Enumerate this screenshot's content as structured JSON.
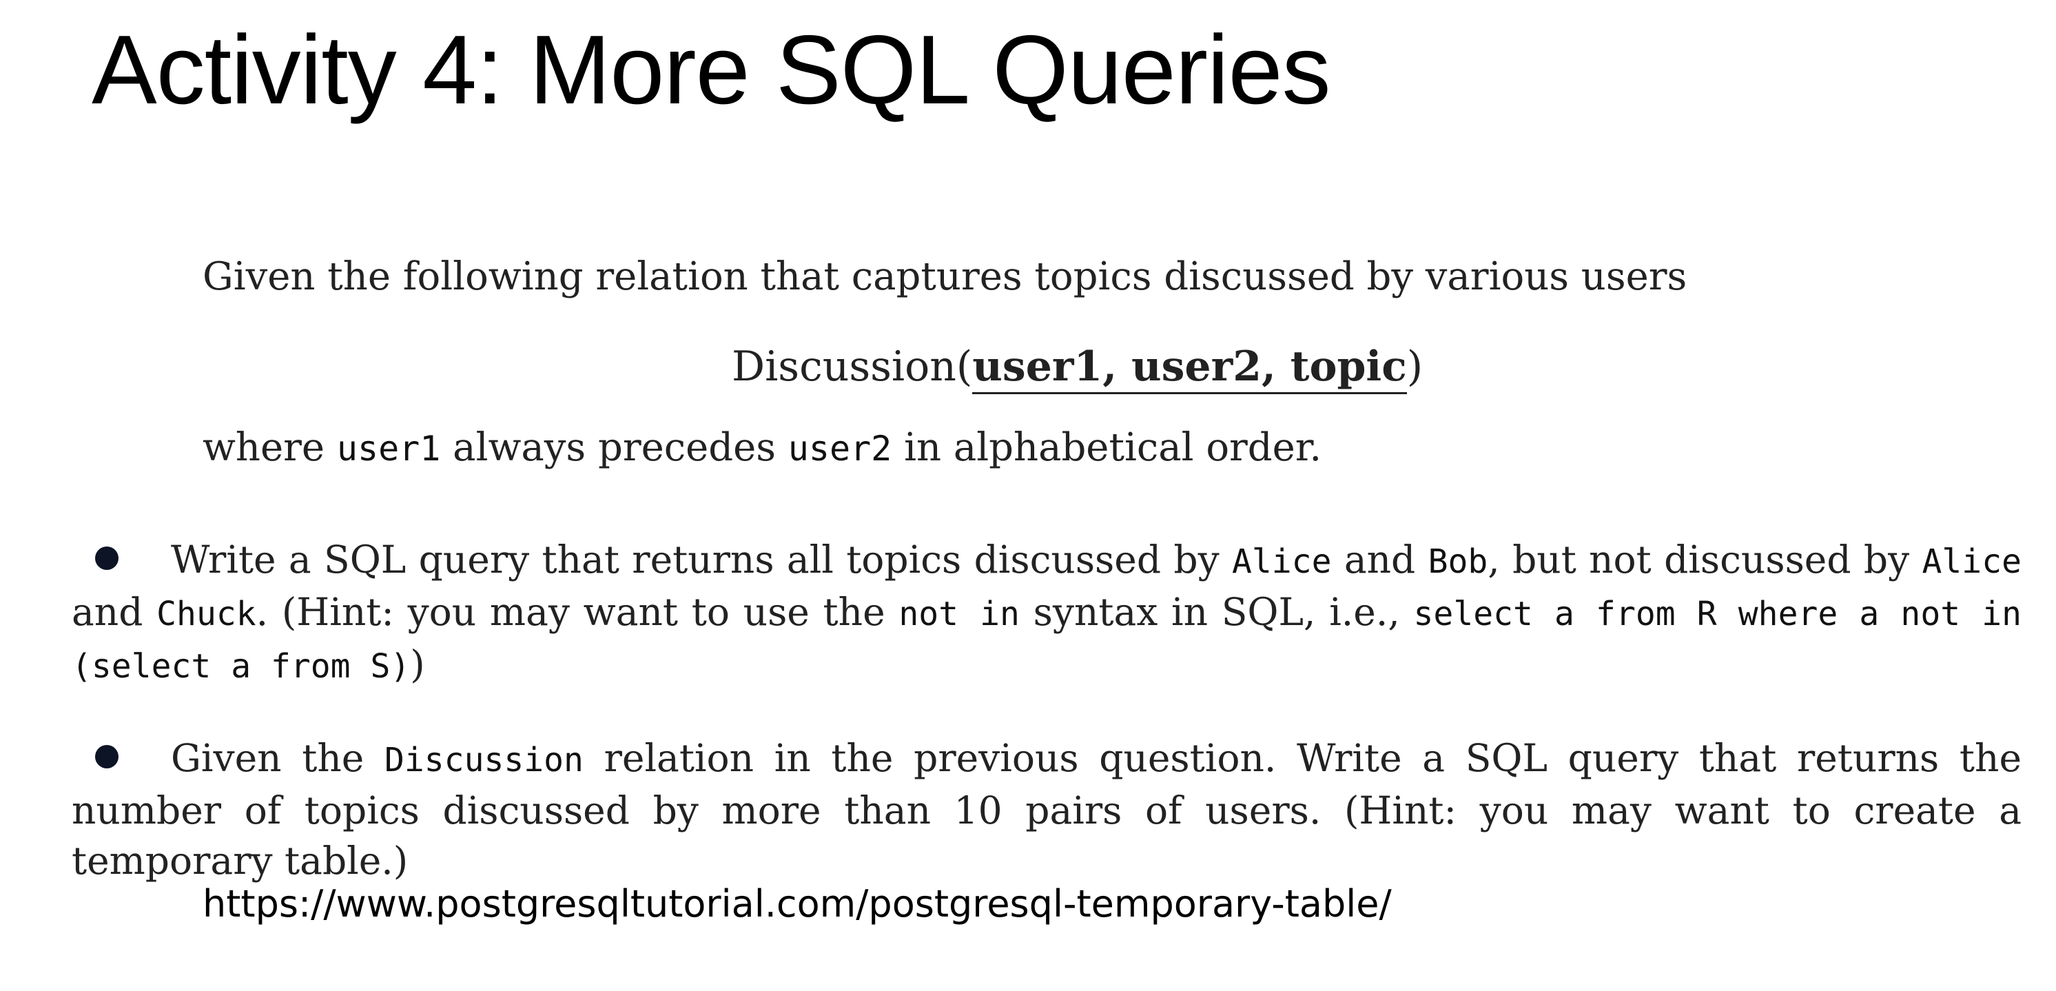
{
  "slide": {
    "title": "Activity 4: More SQL Queries"
  },
  "intro": {
    "text": "Given the following relation that captures topics discussed by various users"
  },
  "relation": {
    "name": "Discussion",
    "open_paren": "(",
    "keys": "user1, user2, topic",
    "close_paren": ")"
  },
  "where_clause": {
    "prefix": "where ",
    "code1": "user1",
    "middle": " always precedes ",
    "code2": "user2",
    "suffix": " in alphabetical order."
  },
  "question1": {
    "t1": "Write a SQL query that returns all topics discussed by ",
    "c1": "Alice",
    "t2": " and ",
    "c2": "Bob",
    "t3": ", but not discussed by ",
    "c3": "Alice",
    "t4": " and ",
    "c4": "Chuck",
    "t5": ". (Hint: you may want to use the ",
    "c5": "not in",
    "t6": " syntax in SQL, i.e., ",
    "c6": "select a from R where a not in (select a from S)",
    "t7": ")"
  },
  "question2": {
    "t1": "Given the ",
    "c1": "Discussion",
    "t2": " relation in the previous question. Write a SQL query that returns the number of topics discussed by more than 10 pairs of users. (Hint: you may want to create a temporary table.)"
  },
  "reference": {
    "url": "https://www.postgresqltutorial.com/postgresql-temporary-table/"
  }
}
